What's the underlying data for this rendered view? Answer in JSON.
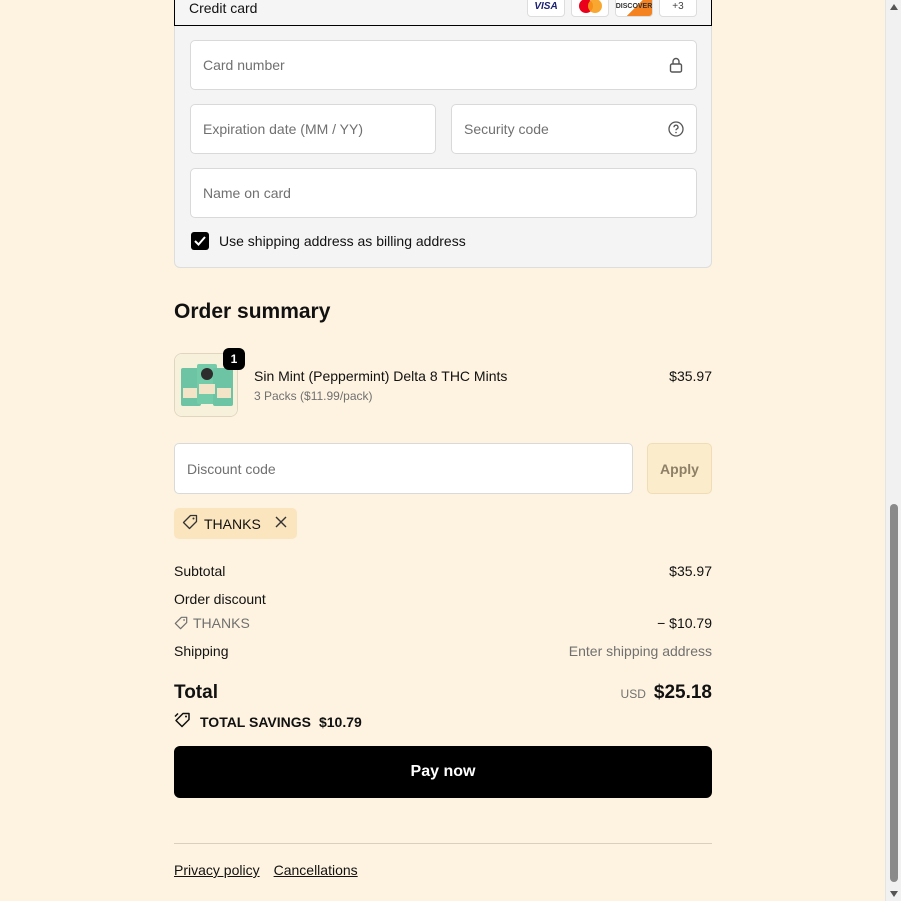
{
  "payment": {
    "method_label": "Credit card",
    "card_logos": [
      "VISA",
      "mastercard",
      "DISCOVER",
      "+3"
    ],
    "card_number_placeholder": "Card number",
    "expiration_placeholder": "Expiration date (MM / YY)",
    "security_code_placeholder": "Security code",
    "name_on_card_placeholder": "Name on card",
    "billing_checkbox_label": "Use shipping address as billing address",
    "billing_checkbox_checked": true
  },
  "order_summary": {
    "heading": "Order summary",
    "item": {
      "name": "Sin Mint (Peppermint) Delta 8 THC Mints",
      "variant": "3 Packs ($11.99/pack)",
      "price": "$35.97",
      "quantity": "1"
    },
    "discount_placeholder": "Discount code",
    "apply_label": "Apply",
    "applied_code": "THANKS",
    "subtotal_label": "Subtotal",
    "subtotal_value": "$35.97",
    "order_discount_label": "Order discount",
    "discount_code_line": "THANKS",
    "discount_value": "− $10.79",
    "shipping_label": "Shipping",
    "shipping_value": "Enter shipping address",
    "total_label": "Total",
    "currency": "USD",
    "total_value": "$25.18",
    "savings_label": "TOTAL SAVINGS",
    "savings_value": "$10.79"
  },
  "actions": {
    "pay_label": "Pay now"
  },
  "footer": {
    "privacy_label": "Privacy policy",
    "cancellations_label": "Cancellations"
  },
  "colors": {
    "page_bg": "#fef3e0",
    "primary_button": "#000000",
    "apply_bg": "#fbeccb",
    "tag_bg": "#fbe5be"
  }
}
